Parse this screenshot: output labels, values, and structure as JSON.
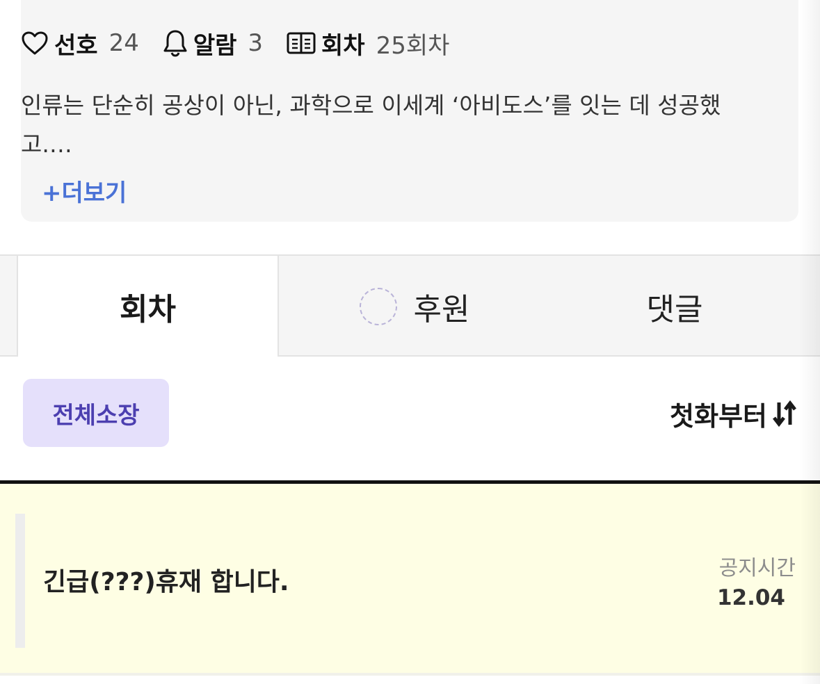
{
  "stats": {
    "favorite": {
      "icon": "heart-icon",
      "label": "선호",
      "count": "24"
    },
    "alarm": {
      "icon": "bell-icon",
      "label": "알람",
      "count": "3"
    },
    "episodes": {
      "icon": "book-icon",
      "label": "회차",
      "count": "25회차"
    }
  },
  "synopsis": {
    "text": "인류는 단순히 공상이 아닌, 과학으로 이세계 ‘아비도스’를 잇는 데 성공했고.…",
    "more_label": "+더보기"
  },
  "tabs": [
    {
      "label": "회차",
      "active": true
    },
    {
      "label": "후원",
      "active": false,
      "icon": "loading-spinner-icon"
    },
    {
      "label": "댓글",
      "active": false
    }
  ],
  "toolbar": {
    "filter_label": "전체소장",
    "sort_label": "첫화부터",
    "sort_icon": "sort-arrows-icon"
  },
  "notice": {
    "title": "긴급(???)휴재 합니다.",
    "time_label": "공지시간",
    "date": "12.04"
  },
  "colors": {
    "link_blue": "#4a72d6",
    "chip_bg": "#e5e0fb",
    "chip_text": "#4c3fb0",
    "notice_bg": "#fefee4"
  }
}
